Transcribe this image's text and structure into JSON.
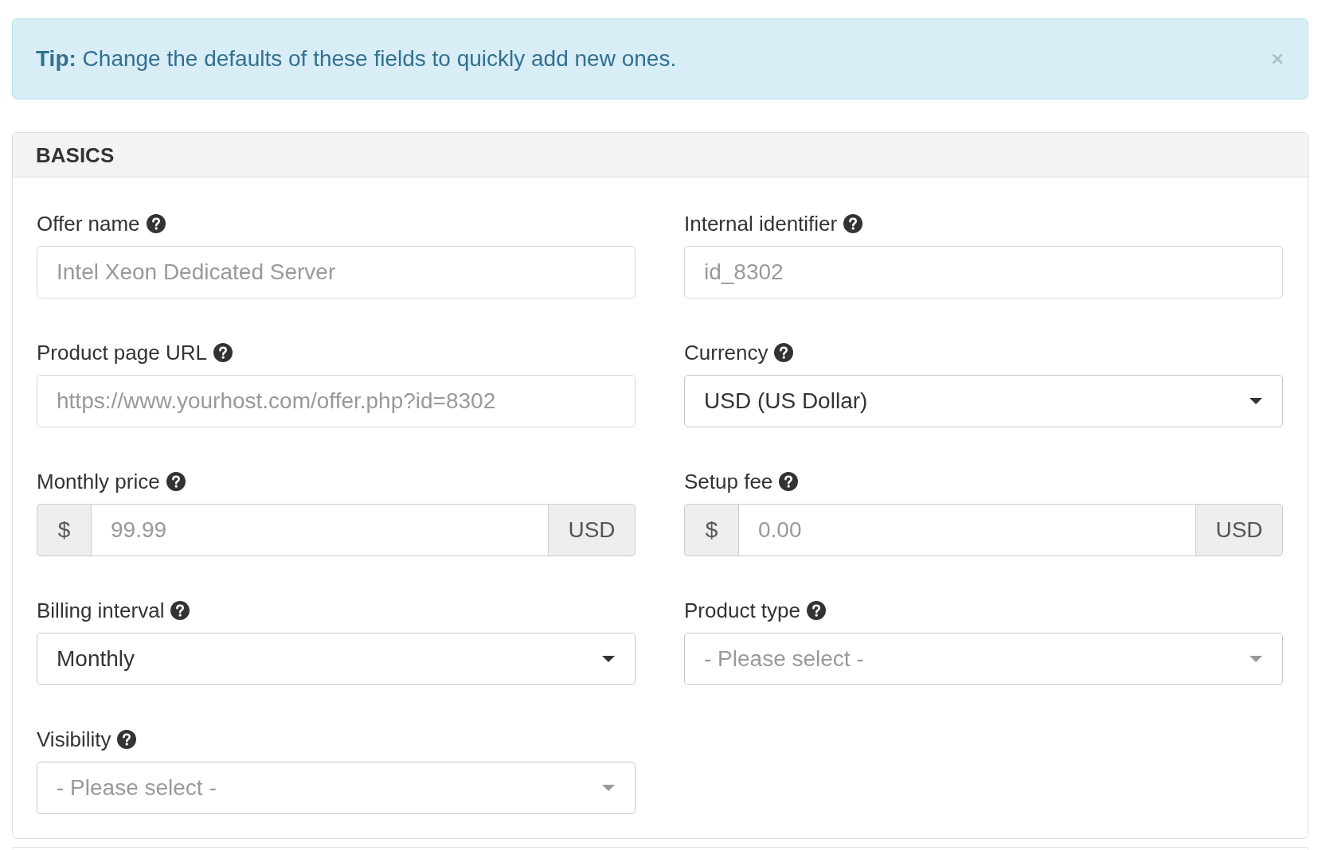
{
  "tip": {
    "text": "**Tip:** Change the defaults of these fields to quickly add new ones."
  },
  "panel": {
    "title": "BASICS",
    "fields": [
      {
        "label": "Offer name",
        "kind": "text",
        "placeholder": "Intel Xeon Dedicated Server"
      },
      {
        "label": "Internal identifier",
        "kind": "text",
        "placeholder": "id_8302"
      },
      {
        "label": "Product page URL",
        "kind": "text",
        "placeholder": "https://www.yourhost.com/offer.php?id=8302"
      },
      {
        "label": "Currency",
        "kind": "select",
        "value": "USD (US Dollar)"
      },
      {
        "label": "Monthly price",
        "kind": "money",
        "prefix": "$",
        "placeholder": "99.99",
        "suffix": "USD"
      },
      {
        "label": "Setup fee",
        "kind": "money",
        "prefix": "$",
        "placeholder": "0.00",
        "suffix": "USD"
      },
      {
        "label": "Billing interval",
        "kind": "select",
        "value": "Monthly"
      },
      {
        "label": "Product type",
        "kind": "select",
        "placeholder": "- Please select -"
      },
      {
        "label": "Visibility",
        "kind": "select",
        "placeholder": "- Please select -"
      }
    ]
  }
}
